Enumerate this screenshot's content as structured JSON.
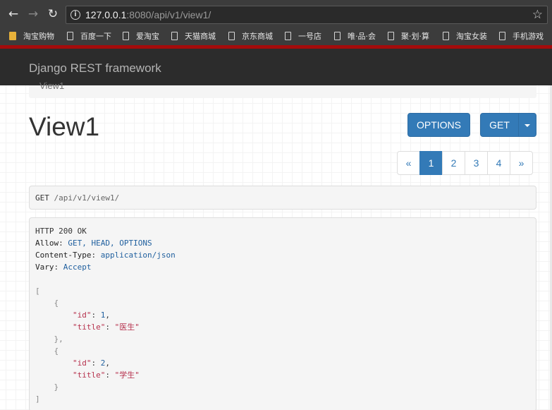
{
  "browser": {
    "url_host": "127.0.0.1",
    "url_rest": ":8080/api/v1/view1/",
    "bookmarks": [
      "淘宝购物",
      "百度一下",
      "爱淘宝",
      "天猫商城",
      "京东商城",
      "一号店",
      "唯·品·会",
      "聚·划·算",
      "淘宝女装",
      "手机游戏"
    ]
  },
  "navbar": {
    "brand": "Django REST framework"
  },
  "breadcrumb": {
    "label": "View1"
  },
  "page": {
    "title": "View1"
  },
  "buttons": {
    "options": "OPTIONS",
    "get": "GET"
  },
  "pagination": {
    "prev": "«",
    "pages": [
      "1",
      "2",
      "3",
      "4"
    ],
    "active": "1",
    "next": "»"
  },
  "request": {
    "method": "GET",
    "path": "/api/v1/view1/"
  },
  "response": {
    "status": "HTTP 200 OK",
    "headers": [
      {
        "key": "Allow",
        "value": "GET, HEAD, OPTIONS"
      },
      {
        "key": "Content-Type",
        "value": "application/json"
      },
      {
        "key": "Vary",
        "value": "Accept"
      }
    ],
    "items": [
      {
        "id": "1",
        "title": "医生"
      },
      {
        "id": "2",
        "title": "学生"
      }
    ]
  },
  "colors": {
    "primary": "#337ab7",
    "navbar": "#2c2c2c",
    "accent_line": "#a40b0b"
  },
  "icons": [
    "back-arrow-icon",
    "forward-arrow-icon",
    "reload-icon",
    "info-icon",
    "star-icon",
    "folder-icon",
    "page-icon",
    "caret-down-icon"
  ]
}
